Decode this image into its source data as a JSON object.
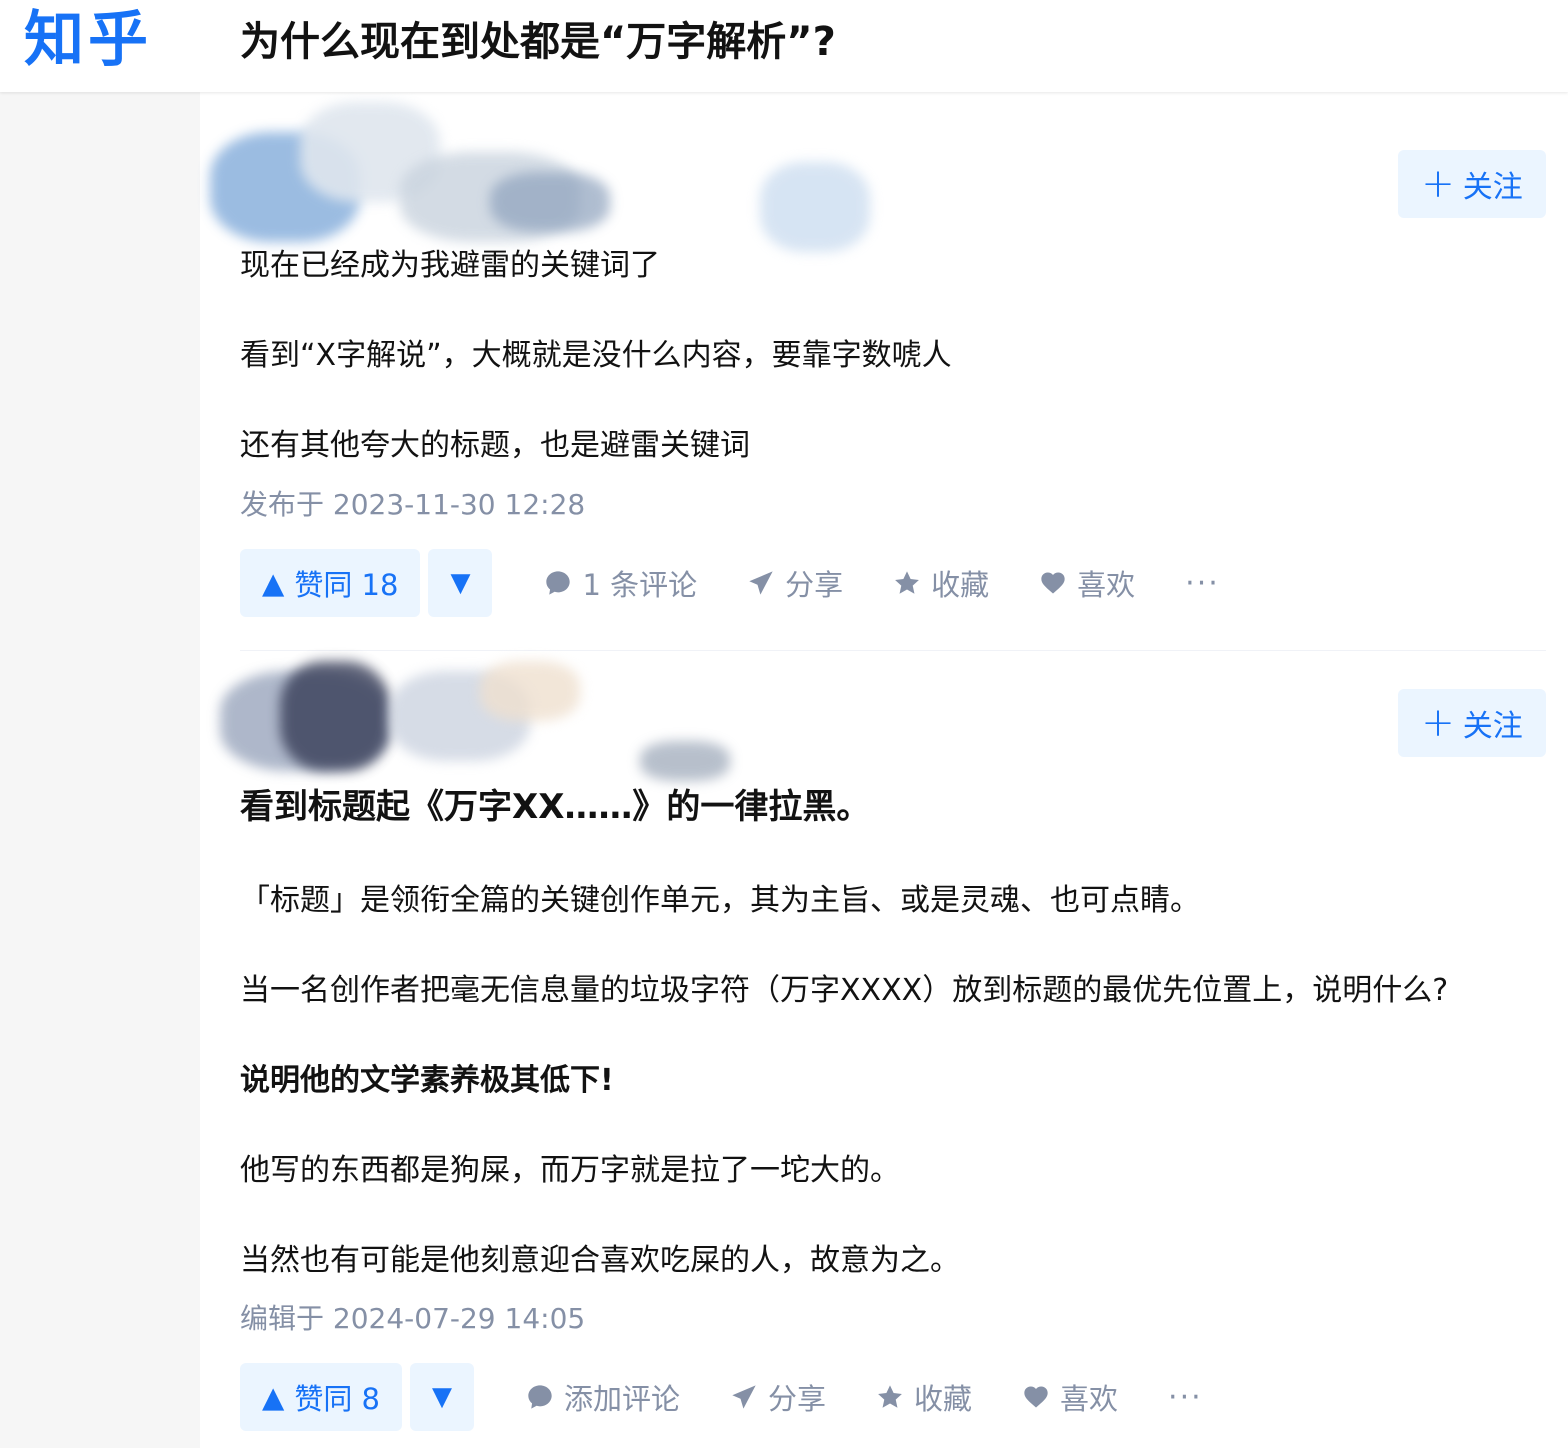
{
  "header": {
    "logo": "知乎",
    "question_title": "为什么现在到处都是“万字解析”?"
  },
  "answers": [
    {
      "follow_label": "关注",
      "paragraphs": [
        "现在已经成为我避雷的关键词了",
        "看到“X字解说”，大概就是没什么内容，要靠字数唬人",
        "还有其他夸大的标题，也是避雷关键词"
      ],
      "timestamp": "发布于 2023-11-30 12:28",
      "upvote": "赞同 18",
      "comment": "1 条评论",
      "share": "分享",
      "favorite": "收藏",
      "like": "喜欢",
      "more": "···"
    },
    {
      "follow_label": "关注",
      "headline": "看到标题起《万字XX……》的一律拉黑。",
      "paragraphs": [
        "「标题」是领衔全篇的关键创作单元，其为主旨、或是灵魂、也可点睛。",
        "当一名创作者把毫无信息量的垃圾字符（万字XXXX）放到标题的最优先位置上，说明什么?",
        "说明他的文学素养极其低下!",
        "他写的东西都是狗屎，而万字就是拉了一坨大的。",
        "当然也有可能是他刻意迎合喜欢吃屎的人，故意为之。"
      ],
      "timestamp": "编辑于 2024-07-29 14:05",
      "upvote": "赞同 8",
      "comment": "添加评论",
      "share": "分享",
      "favorite": "收藏",
      "like": "喜欢",
      "more": "···"
    }
  ],
  "icons": {
    "upvote": "triangle-up-icon",
    "downvote": "triangle-down-icon",
    "comment": "comment-bubble-icon",
    "share": "paper-plane-icon",
    "favorite": "star-icon",
    "like": "heart-icon"
  },
  "colors": {
    "brand": "#1772f6",
    "button_bg": "#ebf5ff",
    "meta_gray": "#8590a6",
    "text": "#121212"
  }
}
